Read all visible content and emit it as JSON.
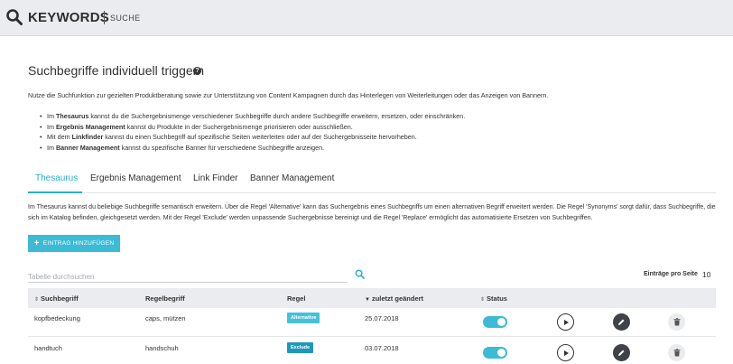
{
  "header": {
    "title": "KEYWORDS",
    "subtitle": "SUCHE"
  },
  "page": {
    "title": "Suchbegriffe individuell triggern",
    "help_glyph": "?",
    "intro": "Nutze die Suchfunktion zur gezielten Produktberatung sowie zur Unterstützung von Content Kampagnen durch das Hinterlegen von Weiterleitungen oder das Anzeigen von Bannern.",
    "bullets": [
      {
        "prefix": "Im ",
        "bold": "Thesaurus",
        "rest": " kannst du die Suchergebnismenge verschiedener Suchbegriffe durch andere Suchbegriffe erweitern, ersetzen, oder einschränken."
      },
      {
        "prefix": "Im ",
        "bold": "Ergebnis Management",
        "rest": " kannst du Produkte in der Suchergebnismenge priorisieren oder ausschließen."
      },
      {
        "prefix": "Mit dem ",
        "bold": "Linkfinder",
        "rest": " kannst du einen Suchbegriff auf spezifische Seiten weiterleiten oder auf der Suchergebnisseite hervorheben."
      },
      {
        "prefix": "Im ",
        "bold": "Banner Management",
        "rest": " kannst du spezifische Banner für verschiedene Suchbegriffe anzeigen."
      }
    ]
  },
  "tabs": [
    {
      "label": "Thesaurus",
      "active": true
    },
    {
      "label": "Ergebnis Management",
      "active": false
    },
    {
      "label": "Link Finder",
      "active": false
    },
    {
      "label": "Banner Management",
      "active": false
    }
  ],
  "tab_description": "Im Thesaurus kannst du beliebige Suchbegriffe semantisch erweitern. Über die Regel 'Alternative' kann das Suchergebnis eines Suchbegriffs um einen alternativen Begriff erweitert werden. Die Regel 'Synonyms' sorgt dafür, dass Suchbegriffe, die sich im Katalog befinden, gleichgesetzt werden. Mit der Regel 'Exclude' werden unpassende Suchergebnisse bereinigt und die Regel 'Replace' ermöglicht das automatisierte Ersetzen von Suchbegriffen.",
  "toolbar": {
    "add_label": "EINTRAG HINZUFÜGEN",
    "search_placeholder": "Tabelle durchsuchen",
    "per_page_label": "Einträge pro Seite",
    "per_page_value": "10"
  },
  "table": {
    "columns": [
      "Suchbegriff",
      "Regelbegriff",
      "Regel",
      "zuletzt geändert",
      "Status"
    ],
    "rows": [
      {
        "suchbegriff": "kopfbedeckung",
        "regelbegriff": "caps, mützen",
        "regel": "Alternative",
        "regel_color": "#46c1d8",
        "datum": "25.07.2018",
        "status_on": true
      },
      {
        "suchbegriff": "handtuch",
        "regelbegriff": "handschuh",
        "regel": "Exclude",
        "regel_color": "#1f97b8",
        "datum": "03.07.2018",
        "status_on": true
      }
    ]
  },
  "colors": {
    "accent": "#2aaed0",
    "button": "#3bbbd6",
    "header_bg": "#ebecef"
  }
}
